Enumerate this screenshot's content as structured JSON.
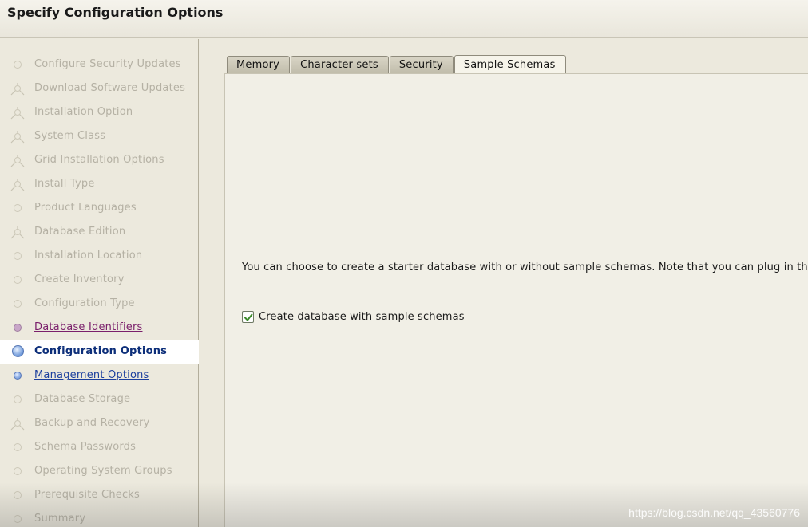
{
  "header": {
    "title": "Specify Configuration Options"
  },
  "sidebar": {
    "steps": [
      {
        "label": "Configure Security Updates",
        "state": "pending"
      },
      {
        "label": "Download Software Updates",
        "state": "pending"
      },
      {
        "label": "Installation Option",
        "state": "pending"
      },
      {
        "label": "System Class",
        "state": "pending"
      },
      {
        "label": "Grid Installation Options",
        "state": "pending"
      },
      {
        "label": "Install Type",
        "state": "pending"
      },
      {
        "label": "Product Languages",
        "state": "pending"
      },
      {
        "label": "Database Edition",
        "state": "pending"
      },
      {
        "label": "Installation Location",
        "state": "pending"
      },
      {
        "label": "Create Inventory",
        "state": "pending"
      },
      {
        "label": "Configuration Type",
        "state": "pending"
      },
      {
        "label": "Database Identifiers",
        "state": "done"
      },
      {
        "label": "Configuration Options",
        "state": "current"
      },
      {
        "label": "Management Options",
        "state": "next"
      },
      {
        "label": "Database Storage",
        "state": "pending"
      },
      {
        "label": "Backup and Recovery",
        "state": "pending"
      },
      {
        "label": "Schema Passwords",
        "state": "pending"
      },
      {
        "label": "Operating System Groups",
        "state": "pending"
      },
      {
        "label": "Prerequisite Checks",
        "state": "pending"
      },
      {
        "label": "Summary",
        "state": "pending"
      }
    ]
  },
  "main": {
    "tabs": [
      {
        "label": "Memory",
        "active": false
      },
      {
        "label": "Character sets",
        "active": false
      },
      {
        "label": "Security",
        "active": false
      },
      {
        "label": "Sample Schemas",
        "active": true
      }
    ],
    "description": "You can choose to create a starter database with or without sample schemas. Note that you can plug in the",
    "checkbox": {
      "label": "Create database with sample schemas",
      "checked": true
    }
  },
  "watermark": "https://blog.csdn.net/qq_43560776",
  "colors": {
    "background": "#ece9dd",
    "current_step_text": "#0d2f7a",
    "done_step_text": "#7a1f6b",
    "next_step_text": "#1c3f9e",
    "check_mark": "#3c8a2a"
  }
}
